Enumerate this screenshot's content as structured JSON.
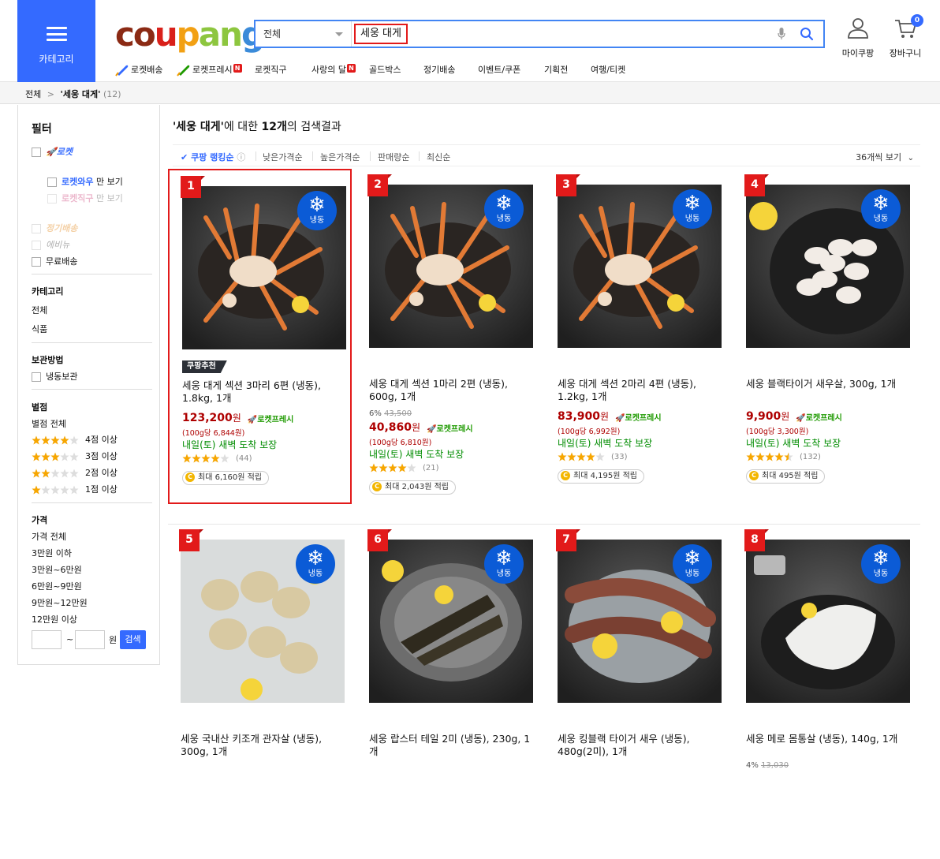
{
  "header": {
    "category_button": "카테고리",
    "logo_letters": [
      {
        "ch": "c",
        "color": "#8b2a14"
      },
      {
        "ch": "o",
        "color": "#8b2a14"
      },
      {
        "ch": "u",
        "color": "#d9201a"
      },
      {
        "ch": "p",
        "color": "#f2a013"
      },
      {
        "ch": "a",
        "color": "#8dc63f"
      },
      {
        "ch": "n",
        "color": "#8dc63f"
      },
      {
        "ch": "g",
        "color": "#3b8bd9"
      }
    ],
    "search_category": "전체",
    "search_query": "세웅 대게",
    "my_coupang": "마이쿠팡",
    "cart": "장바구니",
    "cart_count": "0"
  },
  "nav": [
    {
      "label": "로켓배송",
      "icon": "rocket-blue-icon",
      "badge": ""
    },
    {
      "label": "로켓프레시",
      "icon": "rocket-green-icon",
      "badge": "N"
    },
    {
      "label": "로켓직구",
      "icon": "",
      "badge": ""
    },
    {
      "label": "사랑의 달",
      "icon": "",
      "badge": "N"
    },
    {
      "label": "골드박스",
      "icon": "",
      "badge": ""
    },
    {
      "label": "정기배송",
      "icon": "",
      "badge": ""
    },
    {
      "label": "이벤트/쿠폰",
      "icon": "",
      "badge": ""
    },
    {
      "label": "기획전",
      "icon": "",
      "badge": ""
    },
    {
      "label": "여행/티켓",
      "icon": "",
      "badge": ""
    }
  ],
  "breadcrumb": {
    "root": "전체",
    "current": "'세웅 대게'",
    "count": "(12)"
  },
  "filter": {
    "title": "필터",
    "rocket": "로켓",
    "rocket_wow": "로켓와우",
    "rocket_wow_suffix": "만 보기",
    "rocket_jikgu": "로켓직구",
    "rocket_jikgu_suffix": "만 보기",
    "regular_delivery": "정기배송",
    "coupang_eats": "에비뉴",
    "free_shipping": "무료배송",
    "category_title": "카테고리",
    "category_all": "전체",
    "category_food": "식품",
    "storage_title": "보관방법",
    "storage_frozen": "냉동보관",
    "rating_title": "별점",
    "rating_all": "별점 전체",
    "ratings": [
      {
        "stars": 4,
        "label": "4점 이상"
      },
      {
        "stars": 3,
        "label": "3점 이상"
      },
      {
        "stars": 2,
        "label": "2점 이상"
      },
      {
        "stars": 1,
        "label": "1점 이상"
      }
    ],
    "price_title": "가격",
    "price_all": "가격 전체",
    "price_ranges": [
      "3만원 이하",
      "3만원~6만원",
      "6만원~9만원",
      "9만원~12만원",
      "12만원 이상"
    ],
    "price_tilde": "~",
    "price_unit": "원",
    "price_search": "검색"
  },
  "results": {
    "title_query": "'세웅 대게'",
    "title_mid": "에 대한 ",
    "title_count": "12개",
    "title_end": "의 검색결과"
  },
  "sort": {
    "options": [
      "쿠팡 랭킹순",
      "낮은가격순",
      "높은가격순",
      "판매량순",
      "최신순"
    ],
    "view": "36개씩 보기"
  },
  "products": [
    {
      "rank": "1",
      "name": "세웅 대게 섹션 3마리 6편 (냉동), 1.8kg, 1개",
      "badge": "쿠팡추천",
      "discount": "",
      "orig": "",
      "price": "123,200",
      "won": "원",
      "rocket": "로켓프레시",
      "unit": "(100g당 6,844원)",
      "delivery": "내일(토) 새벽 도착 보장",
      "stars": 4,
      "reviews": "(44)",
      "cash": "최대 6,160원 적립",
      "frozen": "냉동",
      "image": "crab"
    },
    {
      "rank": "2",
      "name": "세웅 대게 섹션 1마리 2편 (냉동), 600g, 1개",
      "badge": "",
      "discount": "6%",
      "orig": "43,500",
      "price": "40,860",
      "won": "원",
      "rocket": "로켓프레시",
      "unit": "(100g당 6,810원)",
      "delivery": "내일(토) 새벽 도착 보장",
      "stars": 4,
      "reviews": "(21)",
      "cash": "최대 2,043원 적립",
      "frozen": "냉동",
      "image": "crab"
    },
    {
      "rank": "3",
      "name": "세웅 대게 섹션 2마리 4편 (냉동), 1.2kg, 1개",
      "badge": "",
      "discount": "",
      "orig": "",
      "price": "83,900",
      "won": "원",
      "rocket": "로켓프레시",
      "unit": "(100g당 6,992원)",
      "delivery": "내일(토) 새벽 도착 보장",
      "stars": 4,
      "reviews": "(33)",
      "cash": "최대 4,195원 적립",
      "frozen": "냉동",
      "image": "crab"
    },
    {
      "rank": "4",
      "name": "세웅 블랙타이거 새우살, 300g, 1개",
      "badge": "",
      "discount": "",
      "orig": "",
      "price": "9,900",
      "won": "원",
      "rocket": "로켓프레시",
      "unit": "(100g당 3,300원)",
      "delivery": "내일(토) 새벽 도착 보장",
      "stars": 4.5,
      "reviews": "(132)",
      "cash": "최대 495원 적립",
      "frozen": "냉동",
      "image": "shrimp"
    },
    {
      "rank": "5",
      "name": "세웅 국내산 키조개 관자살 (냉동), 300g, 1개",
      "frozen": "냉동",
      "image": "scallop"
    },
    {
      "rank": "6",
      "name": "세웅 랍스터 테일 2미 (냉동), 230g, 1개",
      "frozen": "냉동",
      "image": "lobster"
    },
    {
      "rank": "7",
      "name": "세웅 킹블랙 타이거 새우 (냉동), 480g(2미), 1개",
      "frozen": "냉동",
      "image": "prawn"
    },
    {
      "rank": "8",
      "name": "세웅 메로 몸통살 (냉동), 140g, 1개",
      "discount": "4%",
      "orig": "13,030",
      "frozen": "냉동",
      "image": "fish"
    }
  ],
  "colors": {
    "accent": "#346aff",
    "price": "#ae0000",
    "rocket_fresh": "#1e9a00",
    "delivery": "#008c00",
    "rank": "#e21a1a",
    "frozen": "#0b5bd6"
  }
}
